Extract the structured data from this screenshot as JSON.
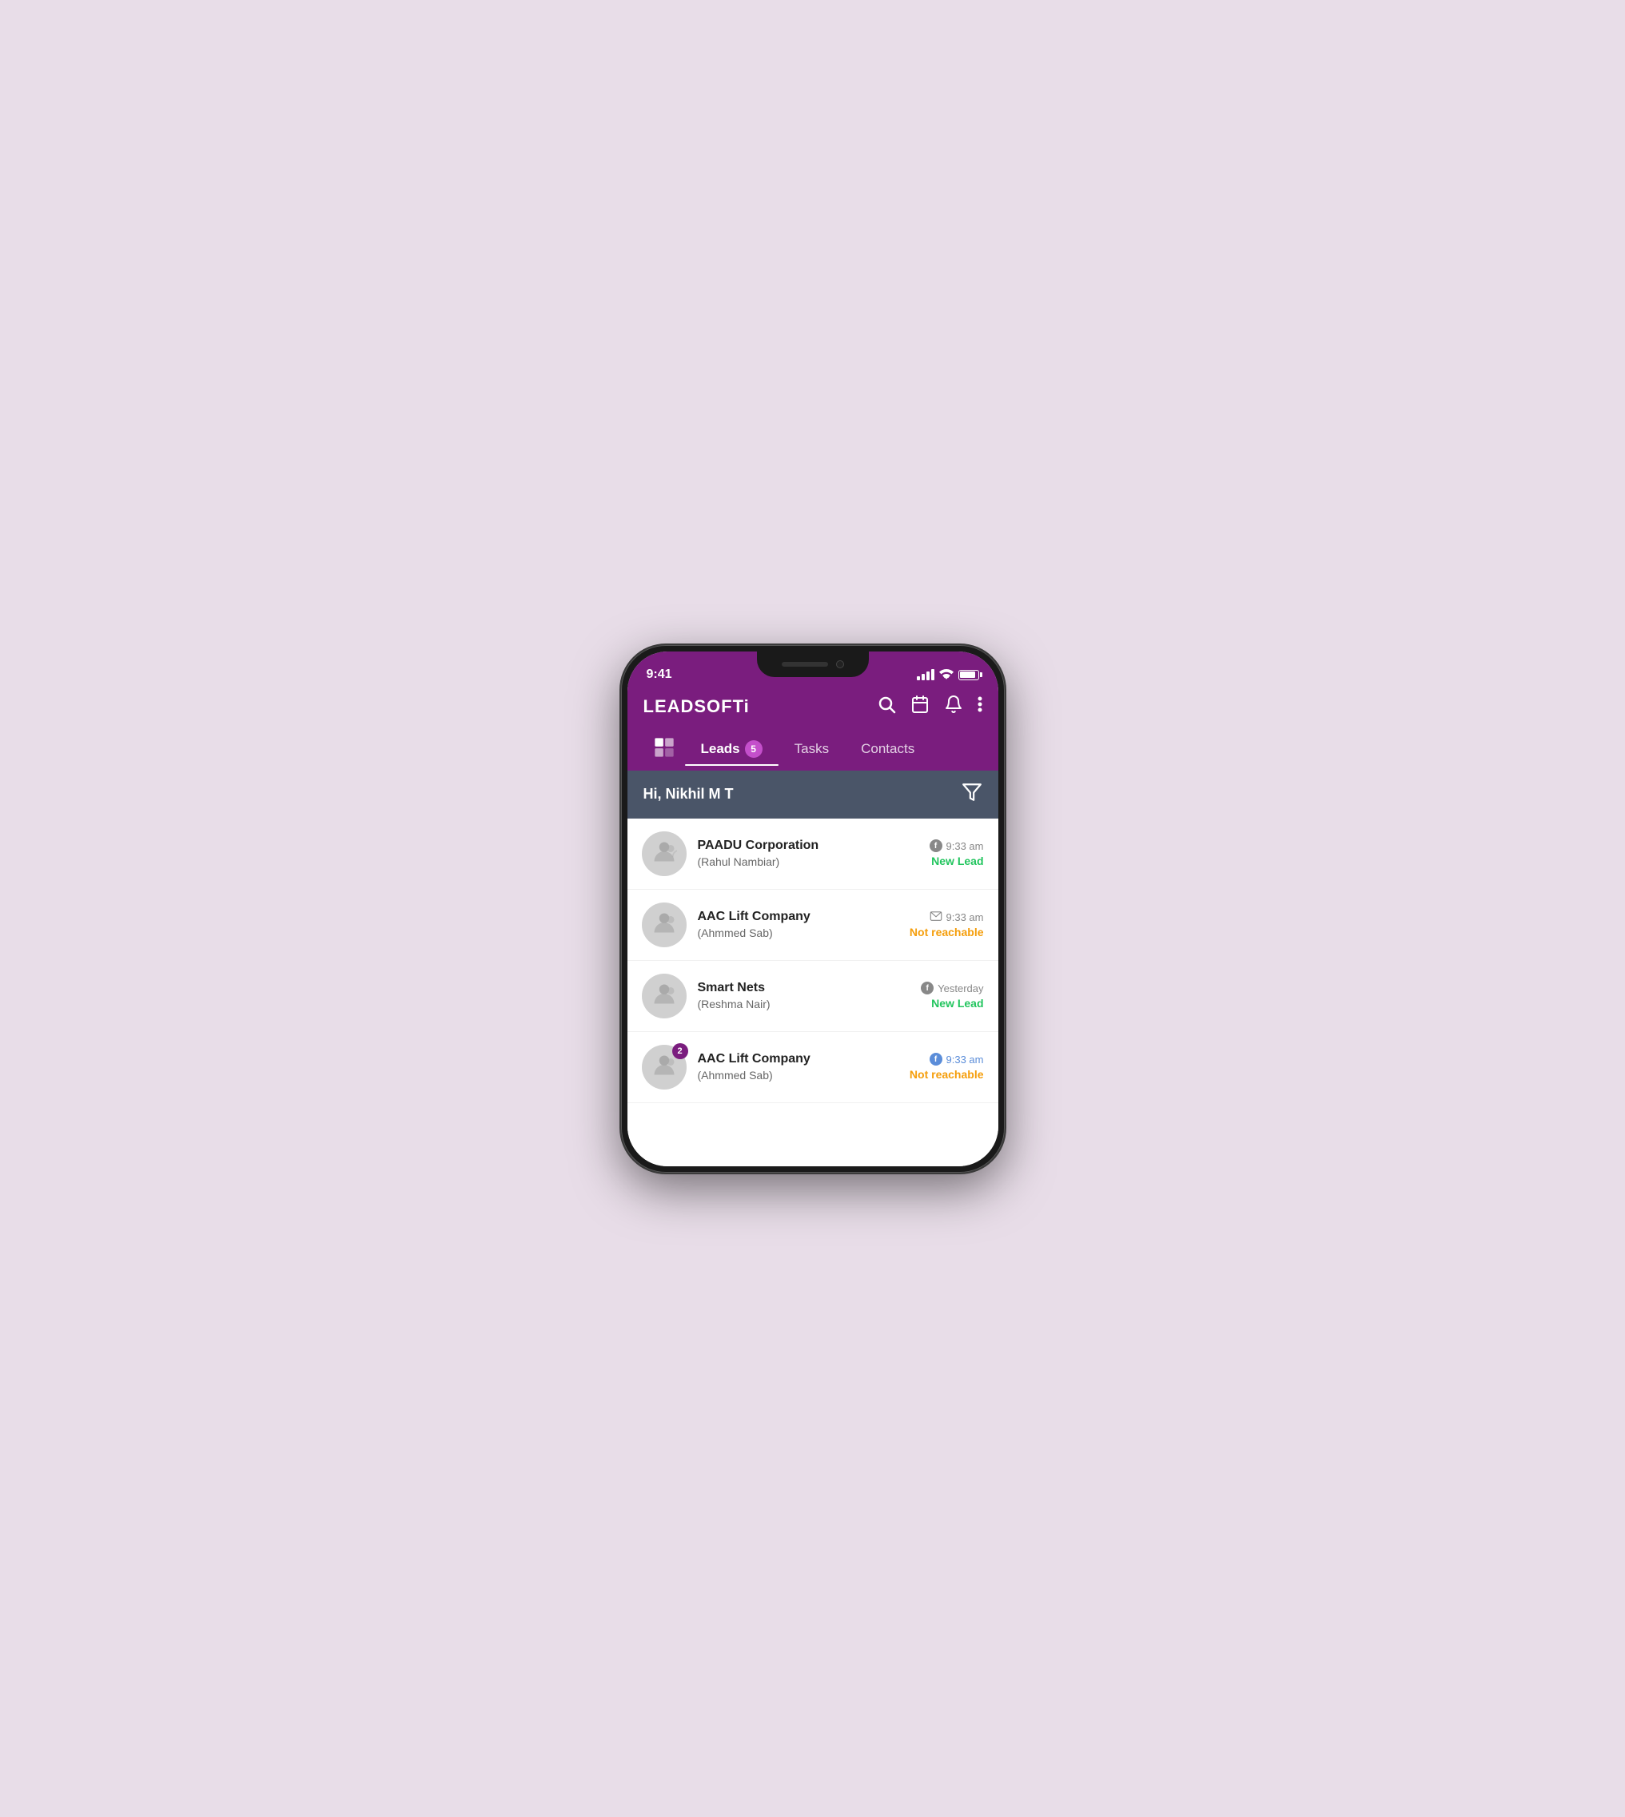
{
  "phone": {
    "status_bar": {
      "time": "9:41",
      "signal_label": "signal",
      "wifi_label": "wifi",
      "battery_label": "battery"
    },
    "header": {
      "logo": "LEADSOFTi",
      "search_icon": "search",
      "calendar_icon": "calendar",
      "bell_icon": "bell",
      "more_icon": "more"
    },
    "tabs": [
      {
        "id": "dashboard",
        "label": "",
        "active": false,
        "badge": null
      },
      {
        "id": "leads",
        "label": "Leads",
        "active": true,
        "badge": "5"
      },
      {
        "id": "tasks",
        "label": "Tasks",
        "active": false,
        "badge": null
      },
      {
        "id": "contacts",
        "label": "Contacts",
        "active": false,
        "badge": null
      }
    ],
    "greeting": "Hi, Nikhil M T",
    "filter_icon": "filter",
    "leads": [
      {
        "id": 1,
        "company": "PAADU Corporation",
        "contact": "(Rahul Nambiar)",
        "source": "facebook",
        "time": "9:33 am",
        "status": "New Lead",
        "status_type": "new",
        "badge": null,
        "time_color": "default",
        "source_color": "gray"
      },
      {
        "id": 2,
        "company": "AAC Lift Company",
        "contact": "(Ahmmed Sab)",
        "source": "email",
        "time": "9:33 am",
        "status": "Not reachable",
        "status_type": "not-reachable",
        "badge": null,
        "time_color": "default",
        "source_color": "gray"
      },
      {
        "id": 3,
        "company": "Smart Nets",
        "contact": "(Reshma Nair)",
        "source": "facebook",
        "time": "Yesterday",
        "status": "New Lead",
        "status_type": "new",
        "badge": null,
        "time_color": "default",
        "source_color": "gray"
      },
      {
        "id": 4,
        "company": "AAC Lift Company",
        "contact": "(Ahmmed Sab)",
        "source": "facebook",
        "time": "9:33 am",
        "status": "Not reachable",
        "status_type": "not-reachable",
        "badge": "2",
        "time_color": "blue",
        "source_color": "blue"
      }
    ]
  }
}
